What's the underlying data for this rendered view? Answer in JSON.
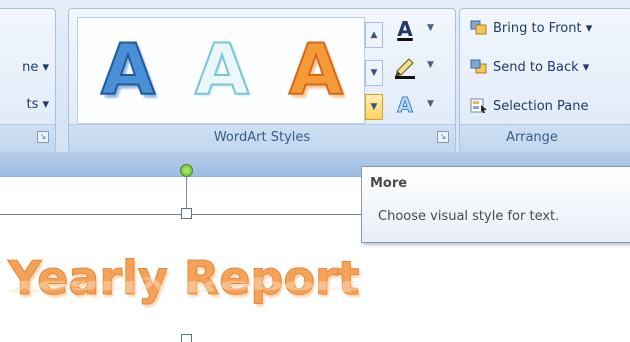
{
  "ribbon": {
    "left_group": {
      "items": [
        "ne ▾",
        "ts ▾"
      ]
    },
    "wordart_group": {
      "label": "WordArt Styles",
      "gallery": [
        {
          "glyph": "A",
          "style": "blue-gradient"
        },
        {
          "glyph": "A",
          "style": "light-cyan-outline"
        },
        {
          "glyph": "A",
          "style": "orange-gradient"
        }
      ],
      "tools": {
        "text_fill": "A",
        "text_outline": "pen",
        "text_effects": "A"
      }
    },
    "arrange_group": {
      "label": "Arrange",
      "items": [
        "Bring to Front ▾",
        "Send to Back ▾",
        "Selection Pane"
      ]
    }
  },
  "document": {
    "heading": "Yearly Report"
  },
  "tooltip": {
    "title": "More",
    "description": "Choose visual style for text."
  },
  "colors": {
    "ribbon_bg": "#dbe7f6",
    "wordart_blue": "#4b8fd6",
    "wordart_orange": "#f59a36",
    "heading_orange": "#f4a259"
  }
}
